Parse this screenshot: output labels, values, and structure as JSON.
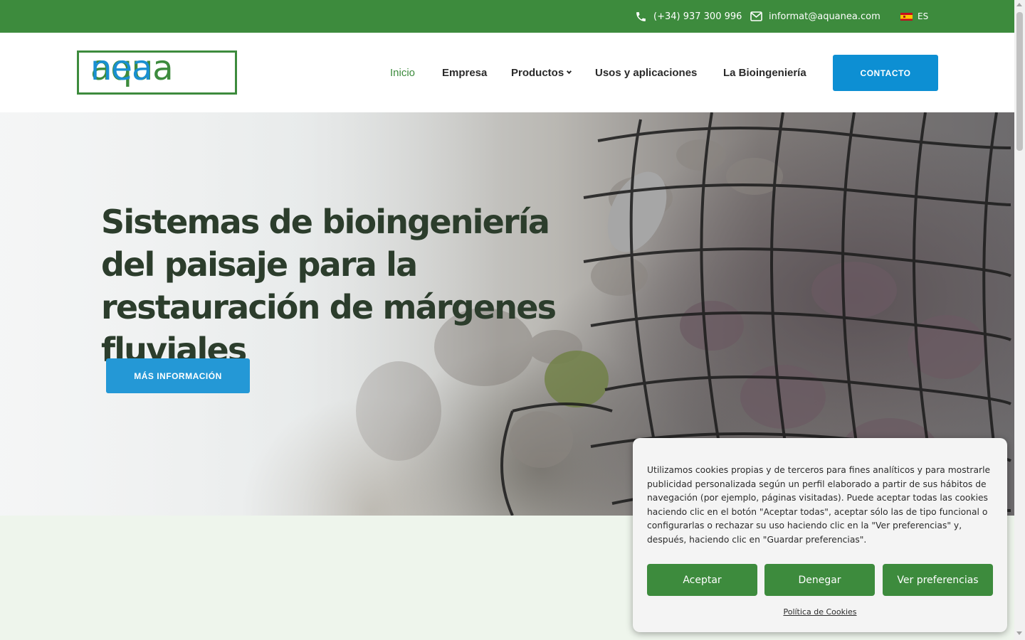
{
  "topbar": {
    "phone": "(+34) 937 300 996",
    "email": "informat@aquanea.com",
    "language": "ES"
  },
  "header": {
    "logo_part1": "aqua",
    "logo_part2": "nea",
    "nav": [
      {
        "label": "Inicio"
      },
      {
        "label": "Empresa"
      },
      {
        "label": "Productos"
      },
      {
        "label": "Usos y aplicaciones"
      },
      {
        "label": "La Bioingeniería"
      }
    ],
    "contact_button": "CONTACTO"
  },
  "hero": {
    "title": "Sistemas de bioingeniería del paisaje para la restauración de márgenes fluviales",
    "button": "MÁS INFORMACIÓN"
  },
  "cookie_banner": {
    "text": "Utilizamos cookies propias y de terceros para fines analíticos y para mostrarle publicidad personalizada según un perfil elaborado a partir de sus hábitos de navegación (por ejemplo, páginas visitadas). Puede aceptar todas las cookies haciendo clic en el botón \"Aceptar todas\", aceptar sólo las de tipo funcional o configurarlas o rechazar su uso haciendo clic en la \"Ver preferencias\" y, después, haciendo clic en \"Guardar preferencias\".",
    "accept": "Aceptar",
    "deny": "Denegar",
    "preferences": "Ver preferencias",
    "policy_link": "Política de Cookies"
  },
  "colors": {
    "brand_green": "#3d8b3d",
    "brand_blue": "#0d8fd3",
    "hero_title": "#2c3d2c"
  },
  "icons": {
    "phone": "phone-icon",
    "email": "envelope-icon",
    "flag": "spain-flag-icon",
    "dropdown": "chevron-down-icon"
  }
}
